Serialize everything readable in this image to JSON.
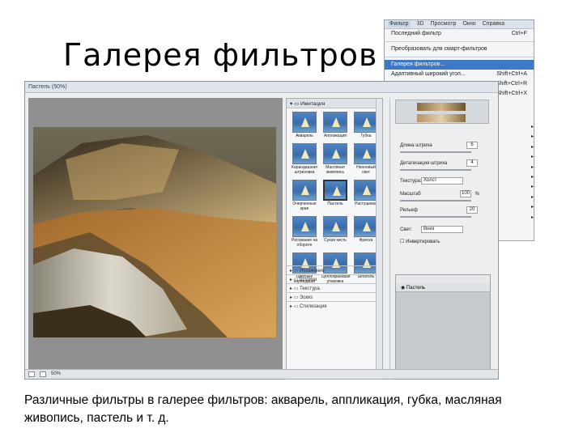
{
  "slide": {
    "title": "Галерея фильтров",
    "caption": "Различные фильтры в галерее фильтров: акварель, аппликация, губка, масляная живопись, пастель и т. д."
  },
  "menu": {
    "bar": [
      "Фильтр",
      "3D",
      "Просмотр",
      "Окно",
      "Справка"
    ],
    "items": [
      {
        "label": "Последний фильтр",
        "shortcut": "Ctrl+F"
      },
      {
        "label": "Преобразовать для смарт-фильтров",
        "shortcut": ""
      },
      {
        "label": "Галерея фильтров...",
        "shortcut": ""
      },
      {
        "label": "Адаптивный широкий угол...",
        "shortcut": "Shift+Ctrl+A"
      }
    ],
    "shortcuts_right": [
      "Shift+Ctrl+R",
      "Shift+Ctrl+X"
    ]
  },
  "dialog": {
    "title": "Пастель (50%)",
    "zoom": "50%",
    "gallery_group": "Имитация",
    "filters": [
      "Акварель",
      "Аппликация",
      "Губка",
      "Карандашная штриховка",
      "Масляная живопись",
      "Неоновый свет",
      "Очерченные края",
      "Пастель",
      "Растушевка",
      "Рисование на обороте",
      "Сухая кисть",
      "Фреска",
      "Цветные карандаши",
      "Целлофановая упаковка",
      "Шпатель"
    ],
    "folders": [
      "Искажение",
      "Штрихи",
      "Текстура",
      "Эскиз",
      "Стилизация"
    ],
    "params": {
      "stroke_length_label": "Длина штриха",
      "stroke_length": "6",
      "detail_label": "Детализация штриха",
      "detail": "4",
      "texture_label": "Текстура:",
      "texture": "Холст",
      "scale_label": "Масштаб",
      "scale": "100",
      "scale_unit": "%",
      "relief_label": "Рельеф",
      "relief": "20",
      "light_label": "Свет:",
      "light": "Вниз",
      "invert_label": "Инвертировать"
    },
    "layer_name": "Пастель"
  }
}
